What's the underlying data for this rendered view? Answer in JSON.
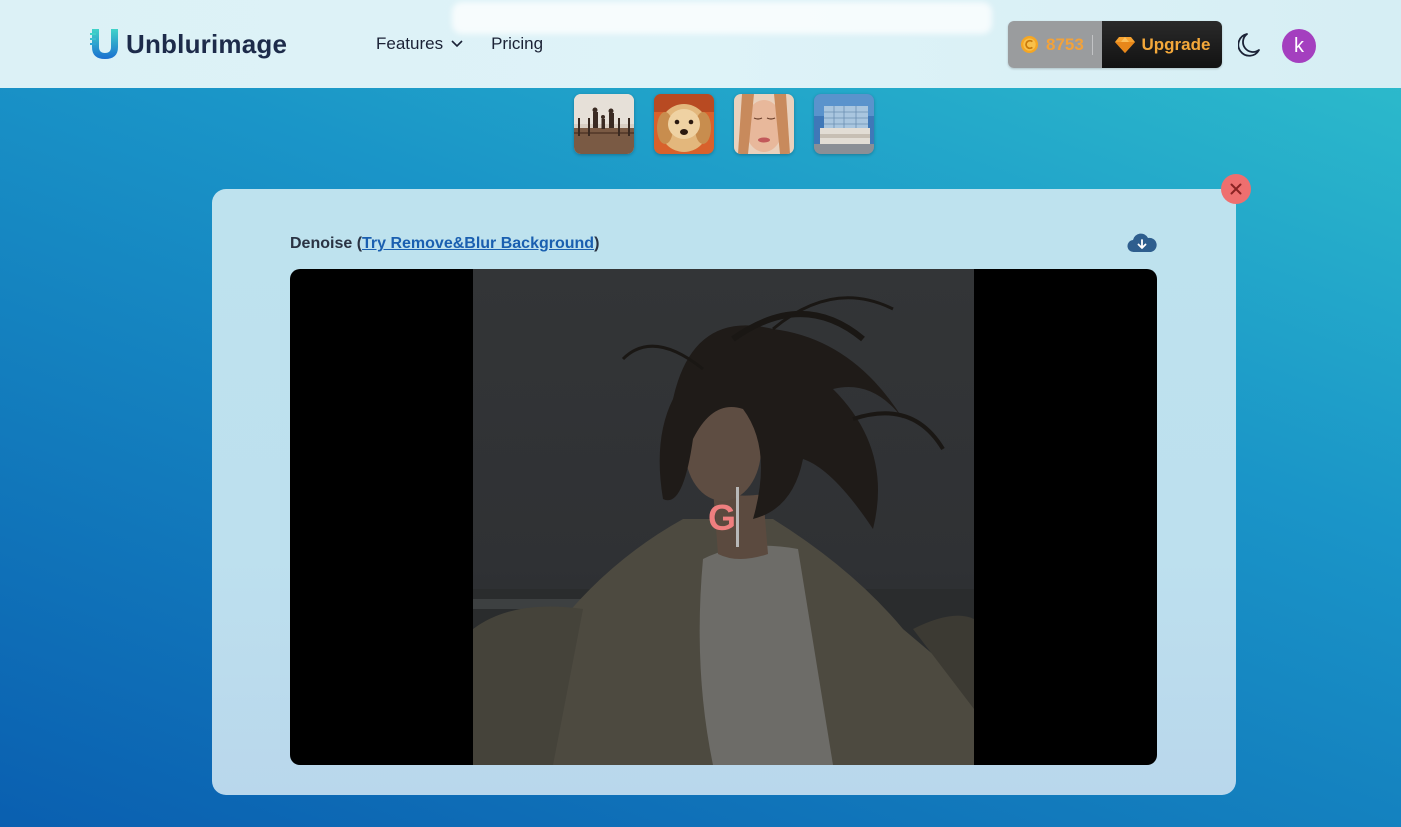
{
  "header": {
    "brand": "Unblurimage",
    "nav": [
      {
        "label": "Features",
        "has_dropdown": true
      },
      {
        "label": "Pricing"
      }
    ],
    "credits": "8753",
    "upgrade_label": "Upgrade",
    "avatar_initial": "k"
  },
  "samples": [
    {
      "name": "family-at-sea"
    },
    {
      "name": "golden-retriever"
    },
    {
      "name": "woman-portrait"
    },
    {
      "name": "modern-building"
    }
  ],
  "result": {
    "title_prefix": "Denoise (",
    "link_label": "Try Remove&Blur Background",
    "title_suffix": ")",
    "overlay_letter": "G"
  },
  "icons": {
    "coin": "coin-icon",
    "upgrade": "gem-icon",
    "theme": "moon-icon",
    "close": "close-icon",
    "download": "cloud-download-icon"
  },
  "colors": {
    "brand_dark": "#1d2b4a",
    "credits_text": "#f2a23b",
    "avatar": "#a43fbf",
    "close_button": "#ee6f6f",
    "link": "#1a5fb0"
  }
}
